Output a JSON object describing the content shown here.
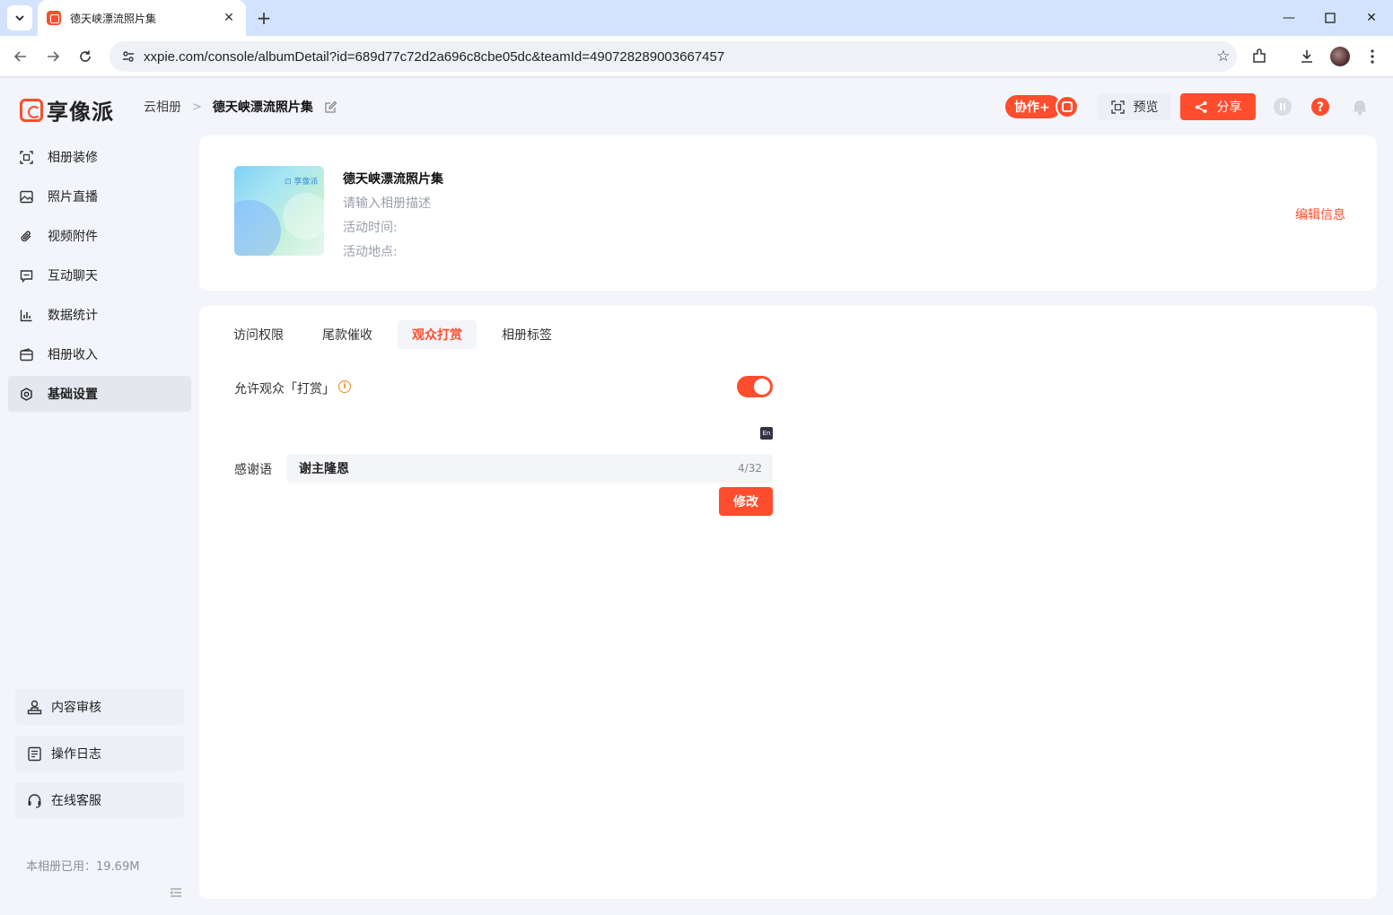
{
  "browser": {
    "tab_title": "德天峡漂流照片集",
    "url": "xxpie.com/console/albumDetail?id=689d77c72d2a696c8cbe05dc&teamId=490728289003667457"
  },
  "header": {
    "logo_text": "享像派",
    "breadcrumb": [
      "云相册",
      "德天峡漂流照片集"
    ],
    "collab_label": "协作+",
    "preview_label": "预览",
    "share_label": "分享"
  },
  "sidebar": {
    "items": [
      {
        "label": "相册装修",
        "icon": "decorate-icon"
      },
      {
        "label": "照片直播",
        "icon": "image-icon"
      },
      {
        "label": "视频附件",
        "icon": "paperclip-icon"
      },
      {
        "label": "互动聊天",
        "icon": "chat-icon"
      },
      {
        "label": "数据统计",
        "icon": "chart-icon"
      },
      {
        "label": "相册收入",
        "icon": "wallet-icon"
      },
      {
        "label": "基础设置",
        "icon": "gear-icon",
        "active": true
      }
    ],
    "bottom": [
      {
        "label": "内容审核",
        "icon": "review-icon"
      },
      {
        "label": "操作日志",
        "icon": "log-icon"
      },
      {
        "label": "在线客服",
        "icon": "headset-icon"
      }
    ],
    "usage": "本相册已用：19.69M"
  },
  "album": {
    "cover_logo": "享像派",
    "title": "德天峡漂流照片集",
    "description_placeholder": "请输入相册描述",
    "time_label": "活动时间:",
    "location_label": "活动地点:",
    "edit_label": "编辑信息"
  },
  "settings": {
    "tabs": [
      "访问权限",
      "尾款催收",
      "观众打赏",
      "相册标签"
    ],
    "active_tab": "观众打赏",
    "allow_tip_label": "允许观众「打赏」",
    "allow_tip_enabled": true,
    "thanks_label": "感谢语",
    "thanks_value": "谢主隆恩",
    "thanks_count": "4/32",
    "save_label": "修改"
  },
  "colors": {
    "accent": "#ff4d2d",
    "warning": "#f08a1c"
  }
}
